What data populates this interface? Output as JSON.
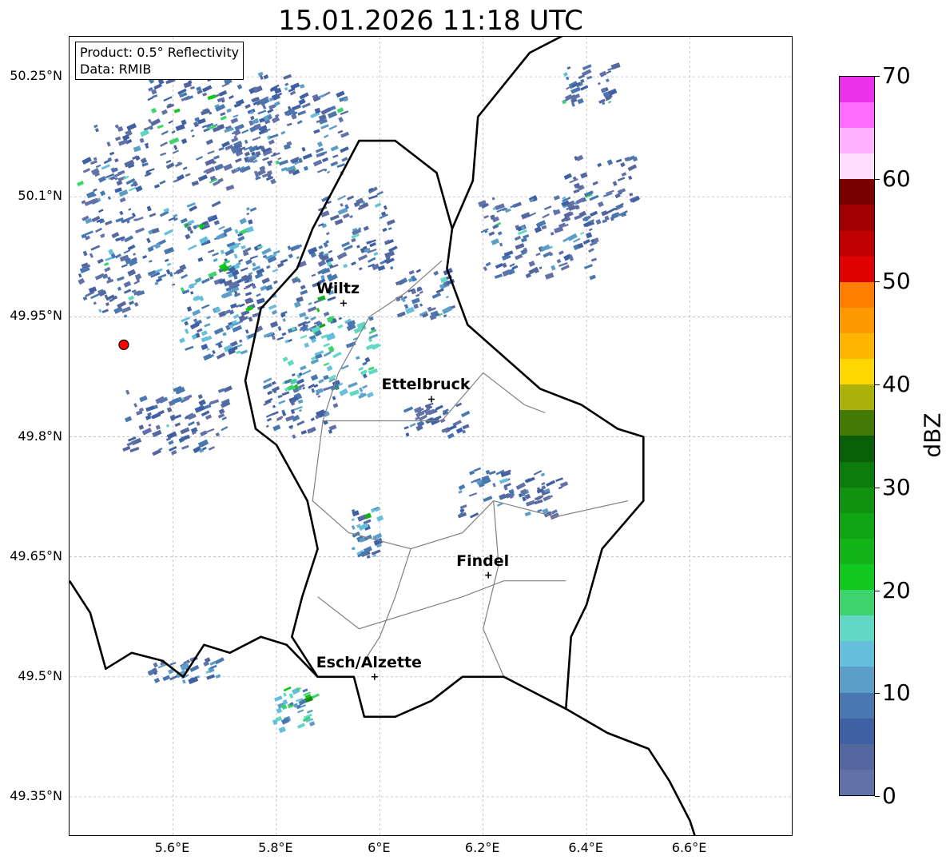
{
  "title": "15.01.2026 11:18 UTC",
  "info_box": {
    "product": "Product: 0.5° Reflectivity",
    "data": "Data: RMIB"
  },
  "axes": {
    "lon_ticks": [
      "5.6°E",
      "5.8°E",
      "6°E",
      "6.2°E",
      "6.4°E",
      "6.6°E"
    ],
    "lat_ticks": [
      "50.25°N",
      "50.1°N",
      "49.95°N",
      "49.8°N",
      "49.65°N",
      "49.5°N",
      "49.35°N"
    ],
    "extent": {
      "lon_min": 5.4,
      "lon_max": 6.8,
      "lat_min": 49.3,
      "lat_max": 50.3
    }
  },
  "cities": [
    {
      "name": "Wiltz",
      "lon": 5.93,
      "lat": 49.967
    },
    {
      "name": "Ettelbruck",
      "lon": 6.1,
      "lat": 49.847
    },
    {
      "name": "Findel",
      "lon": 6.21,
      "lat": 49.627
    },
    {
      "name": "Esch/Alzette",
      "lon": 5.99,
      "lat": 49.5
    }
  ],
  "radar_site": {
    "lon": 5.505,
    "lat": 49.915,
    "color": "#ff0000"
  },
  "colorbar": {
    "label": "dBZ",
    "min": 0,
    "max": 70,
    "step": 2.5,
    "tick_labels": [
      "0",
      "10",
      "20",
      "30",
      "40",
      "50",
      "60",
      "70"
    ],
    "colors": [
      "#6272a8",
      "#54689f",
      "#4060a4",
      "#4978b0",
      "#5c9ec7",
      "#66bedd",
      "#60d8c3",
      "#3ed46d",
      "#12c71d",
      "#12b418",
      "#10a613",
      "#0f920f",
      "#0b7b0b",
      "#085f08",
      "#437a06",
      "#abb108",
      "#fed600",
      "#fdb600",
      "#fe9800",
      "#fe7f00",
      "#e00000",
      "#c00000",
      "#a00000",
      "#7a0000",
      "#ffddff",
      "#ffb2ff",
      "#ff6bff",
      "#ea32ea"
    ]
  },
  "radar_patches": [
    {
      "lon": 5.7,
      "lat": 50.22,
      "w": 0.3,
      "h": 0.07,
      "dbz": 5
    },
    {
      "lon": 5.62,
      "lat": 50.15,
      "w": 0.35,
      "h": 0.08,
      "dbz": 4
    },
    {
      "lon": 5.82,
      "lat": 50.18,
      "w": 0.22,
      "h": 0.1,
      "dbz": 6
    },
    {
      "lon": 5.47,
      "lat": 50.05,
      "w": 0.12,
      "h": 0.2,
      "dbz": 4
    },
    {
      "lon": 5.65,
      "lat": 50.04,
      "w": 0.22,
      "h": 0.1,
      "dbz": 8
    },
    {
      "lon": 5.8,
      "lat": 49.98,
      "w": 0.2,
      "h": 0.12,
      "dbz": 7
    },
    {
      "lon": 5.68,
      "lat": 49.95,
      "w": 0.14,
      "h": 0.1,
      "dbz": 9
    },
    {
      "lon": 5.95,
      "lat": 50.06,
      "w": 0.14,
      "h": 0.1,
      "dbz": 5
    },
    {
      "lon": 5.9,
      "lat": 49.9,
      "w": 0.18,
      "h": 0.1,
      "dbz": 12
    },
    {
      "lon": 5.84,
      "lat": 49.84,
      "w": 0.14,
      "h": 0.08,
      "dbz": 6
    },
    {
      "lon": 5.6,
      "lat": 49.82,
      "w": 0.2,
      "h": 0.08,
      "dbz": 4
    },
    {
      "lon": 6.08,
      "lat": 49.98,
      "w": 0.1,
      "h": 0.06,
      "dbz": 5
    },
    {
      "lon": 6.3,
      "lat": 50.05,
      "w": 0.22,
      "h": 0.1,
      "dbz": 5
    },
    {
      "lon": 6.42,
      "lat": 50.11,
      "w": 0.14,
      "h": 0.08,
      "dbz": 4
    },
    {
      "lon": 6.4,
      "lat": 50.24,
      "w": 0.1,
      "h": 0.05,
      "dbz": 4
    },
    {
      "lon": 6.25,
      "lat": 49.73,
      "w": 0.2,
      "h": 0.06,
      "dbz": 5
    },
    {
      "lon": 6.1,
      "lat": 49.82,
      "w": 0.12,
      "h": 0.04,
      "dbz": 4
    },
    {
      "lon": 5.97,
      "lat": 49.68,
      "w": 0.05,
      "h": 0.06,
      "dbz": 9
    },
    {
      "lon": 5.83,
      "lat": 49.46,
      "w": 0.08,
      "h": 0.05,
      "dbz": 14
    },
    {
      "lon": 5.62,
      "lat": 49.51,
      "w": 0.14,
      "h": 0.03,
      "dbz": 6
    }
  ],
  "borders": {
    "country": [
      [
        [
          5.4,
          49.62
        ],
        [
          5.44,
          49.58
        ],
        [
          5.47,
          49.51
        ],
        [
          5.52,
          49.53
        ],
        [
          5.58,
          49.52
        ],
        [
          5.62,
          49.5
        ],
        [
          5.66,
          49.54
        ],
        [
          5.71,
          49.53
        ],
        [
          5.77,
          49.55
        ],
        [
          5.82,
          49.54
        ],
        [
          5.88,
          49.5
        ],
        [
          5.95,
          49.5
        ],
        [
          5.97,
          49.45
        ],
        [
          6.03,
          49.45
        ],
        [
          6.1,
          49.47
        ],
        [
          6.16,
          49.5
        ],
        [
          6.24,
          49.5
        ],
        [
          6.36,
          49.46
        ],
        [
          6.44,
          49.43
        ],
        [
          6.52,
          49.41
        ],
        [
          6.56,
          49.37
        ],
        [
          6.6,
          49.32
        ],
        [
          6.62,
          49.28
        ]
      ],
      [
        [
          5.88,
          49.5
        ],
        [
          5.83,
          49.55
        ],
        [
          5.85,
          49.6
        ],
        [
          5.88,
          49.66
        ],
        [
          5.86,
          49.72
        ],
        [
          5.8,
          49.79
        ],
        [
          5.76,
          49.81
        ],
        [
          5.74,
          49.87
        ],
        [
          5.77,
          49.96
        ],
        [
          5.84,
          50.01
        ],
        [
          5.87,
          50.06
        ],
        [
          5.96,
          50.17
        ],
        [
          6.03,
          50.17
        ],
        [
          6.11,
          50.13
        ],
        [
          6.14,
          50.06
        ],
        [
          6.13,
          50.01
        ],
        [
          6.17,
          49.94
        ],
        [
          6.24,
          49.9
        ],
        [
          6.31,
          49.86
        ],
        [
          6.39,
          49.84
        ],
        [
          6.46,
          49.81
        ],
        [
          6.51,
          49.8
        ],
        [
          6.51,
          49.72
        ],
        [
          6.43,
          49.66
        ],
        [
          6.4,
          49.59
        ],
        [
          6.37,
          49.55
        ],
        [
          6.36,
          49.46
        ]
      ],
      [
        [
          6.14,
          50.06
        ],
        [
          6.18,
          50.12
        ],
        [
          6.19,
          50.2
        ],
        [
          6.29,
          50.28
        ],
        [
          6.38,
          50.31
        ]
      ]
    ],
    "district": [
      [
        [
          6.12,
          50.02
        ],
        [
          6.05,
          49.98
        ],
        [
          5.98,
          49.95
        ],
        [
          5.92,
          49.88
        ],
        [
          5.89,
          49.82
        ],
        [
          6.02,
          49.82
        ],
        [
          6.12,
          49.82
        ],
        [
          6.2,
          49.88
        ],
        [
          6.28,
          49.84
        ],
        [
          6.32,
          49.83
        ]
      ],
      [
        [
          5.89,
          49.82
        ],
        [
          5.87,
          49.72
        ],
        [
          5.94,
          49.68
        ],
        [
          6.06,
          49.66
        ],
        [
          6.16,
          49.68
        ],
        [
          6.22,
          49.72
        ],
        [
          6.34,
          49.7
        ],
        [
          6.48,
          49.72
        ]
      ],
      [
        [
          5.88,
          49.6
        ],
        [
          5.96,
          49.56
        ],
        [
          6.06,
          49.58
        ],
        [
          6.16,
          49.6
        ],
        [
          6.24,
          49.62
        ],
        [
          6.36,
          49.62
        ]
      ],
      [
        [
          6.06,
          49.66
        ],
        [
          6.03,
          49.6
        ],
        [
          6.0,
          49.55
        ],
        [
          5.97,
          49.52
        ]
      ],
      [
        [
          6.22,
          49.72
        ],
        [
          6.23,
          49.64
        ],
        [
          6.2,
          49.56
        ],
        [
          6.24,
          49.5
        ]
      ]
    ]
  }
}
